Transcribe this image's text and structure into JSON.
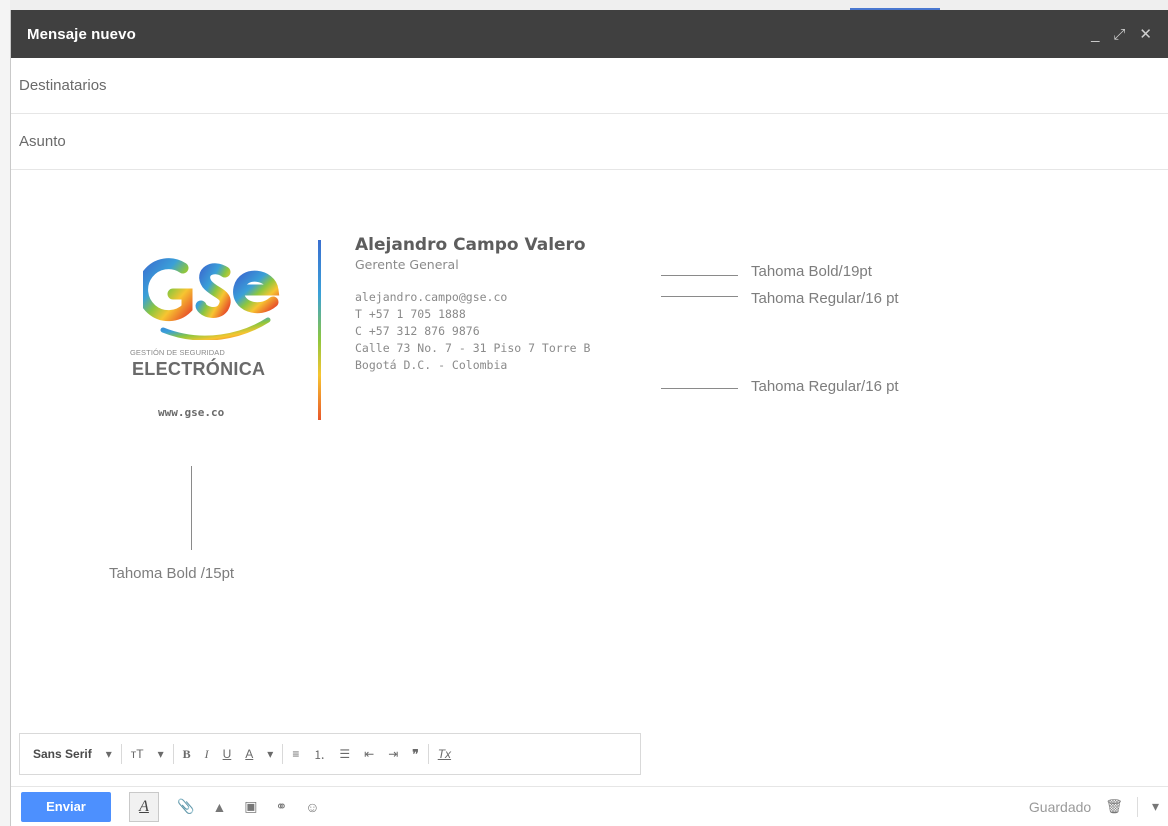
{
  "window": {
    "title": "Mensaje nuevo",
    "controls": {
      "minimize": "_",
      "expand": "⤢",
      "close": "✕"
    }
  },
  "fields": {
    "to_placeholder": "Destinatarios",
    "subject_placeholder": "Asunto"
  },
  "signature": {
    "logo": {
      "sub": "GESTIÓN DE SEGURIDAD",
      "main": "ELECTRÓNICA",
      "web": "www.gse.co",
      "bar_colors": [
        "#3a6fd0",
        "#3aa0d8",
        "#8cc63f",
        "#f7c531",
        "#e8572a"
      ]
    },
    "name": "Alejandro Campo Valero",
    "role": "Gerente General",
    "lines": [
      "alejandro.campo@gse.co",
      "T +57 1 705 1888",
      "C +57 312 876 9876",
      "Calle 73 No. 7 - 31 Piso 7 Torre B",
      "Bogotá D.C. - Colombia"
    ]
  },
  "annotations": {
    "name_font": "Tahoma Bold/19pt",
    "role_font": "Tahoma Regular/16 pt",
    "body_font": "Tahoma Regular/16 pt",
    "logo_font": "Tahoma Bold /15pt"
  },
  "formatting_toolbar": {
    "font_family": "Sans Serif",
    "size_label": "тT",
    "bold": "B",
    "italic": "I",
    "underline": "U",
    "text_color": "A",
    "align": "≡",
    "numbered_list": "⒈",
    "bulleted_list": "☰",
    "indent_less": "⇤",
    "indent_more": "⇥",
    "quote": "❞",
    "clear_format": "Tx",
    "dropdown": "▾"
  },
  "bottom_bar": {
    "send_label": "Enviar",
    "format_label": "A",
    "status": "Guardado",
    "icons": [
      "attach-icon",
      "drive-icon",
      "photo-icon",
      "link-icon",
      "emoji-icon",
      "trash-icon",
      "more-icon"
    ]
  },
  "colors": {
    "titlebar": "#404040",
    "send": "#4d90fe"
  }
}
